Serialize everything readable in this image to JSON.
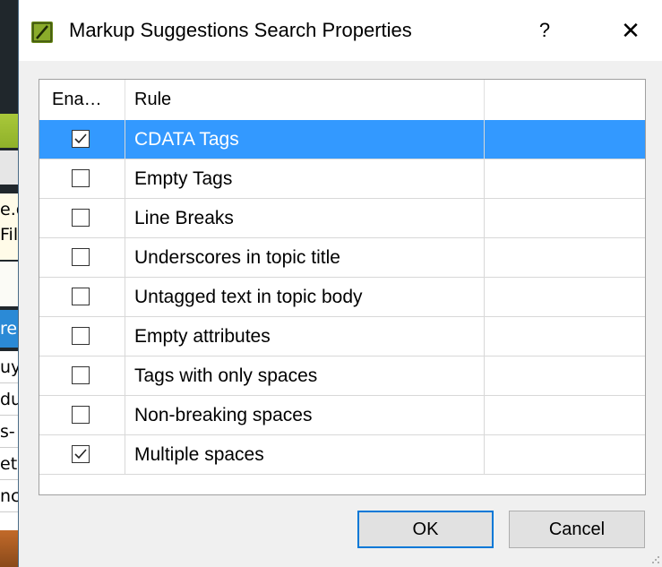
{
  "dialog": {
    "title": "Markup Suggestions Search Properties",
    "help_label": "?",
    "close_label": "✕"
  },
  "table": {
    "columns": [
      "Ena…",
      "Rule",
      ""
    ],
    "rows": [
      {
        "enabled": true,
        "rule": "CDATA Tags",
        "selected": true
      },
      {
        "enabled": false,
        "rule": "Empty Tags",
        "selected": false
      },
      {
        "enabled": false,
        "rule": "Line Breaks",
        "selected": false
      },
      {
        "enabled": false,
        "rule": "Underscores in topic title",
        "selected": false
      },
      {
        "enabled": false,
        "rule": "Untagged text in topic body",
        "selected": false
      },
      {
        "enabled": false,
        "rule": "Empty attributes",
        "selected": false
      },
      {
        "enabled": false,
        "rule": "Tags with only spaces",
        "selected": false
      },
      {
        "enabled": false,
        "rule": "Non-breaking spaces",
        "selected": false
      },
      {
        "enabled": true,
        "rule": "Multiple spaces",
        "selected": false
      }
    ]
  },
  "buttons": {
    "ok": "OK",
    "cancel": "Cancel"
  },
  "background": {
    "fragments": [
      "e.g",
      "Fil",
      "re",
      "uy",
      "du",
      "s-",
      "et",
      "nc"
    ]
  },
  "colors": {
    "selection": "#3399ff",
    "default_button_border": "#0078d7",
    "app_icon": "#6b8a1a"
  }
}
